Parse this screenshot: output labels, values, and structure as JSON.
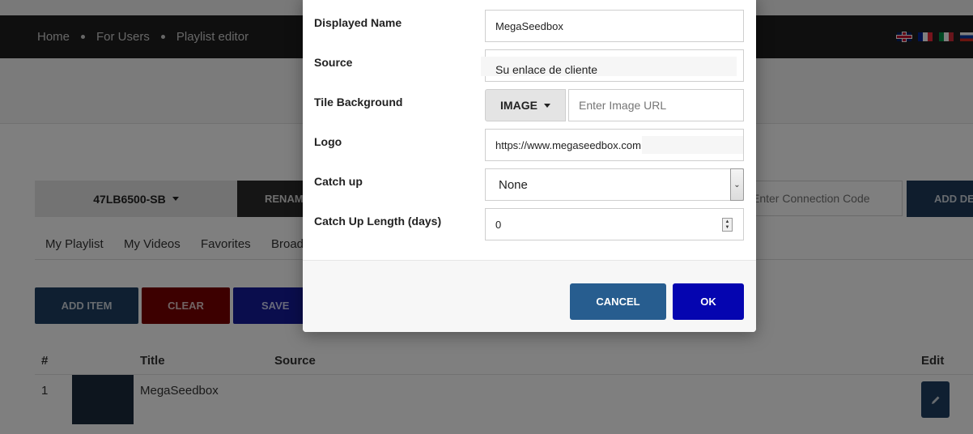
{
  "nav": {
    "breadcrumbs": [
      "Home",
      "For Users",
      "Playlist editor"
    ],
    "languages": [
      "flag-en-icon",
      "flag-fr-icon",
      "flag-it-icon",
      "flag-ru-icon"
    ]
  },
  "device": {
    "selected": "47LB6500-SB",
    "rename_label": "RENAME",
    "connection_placeholder": "Enter Connection Code",
    "add_device_label": "ADD DEVICE"
  },
  "tabs": [
    "My Playlist",
    "My Videos",
    "Favorites",
    "Broadcast"
  ],
  "actions": {
    "add_item": "ADD ITEM",
    "clear": "CLEAR",
    "save": "SAVE"
  },
  "table": {
    "headers": {
      "num": "#",
      "title": "Title",
      "source": "Source",
      "edit": "Edit"
    },
    "rows": [
      {
        "num": "1",
        "title": "MegaSeedbox"
      }
    ]
  },
  "modal": {
    "fields": {
      "displayed_name": {
        "label": "Displayed Name",
        "value": "MegaSeedbox"
      },
      "source": {
        "label": "Source",
        "value": "Su enlace de cliente"
      },
      "tile_background": {
        "label": "Tile Background",
        "button": "IMAGE",
        "placeholder": "Enter Image URL"
      },
      "logo": {
        "label": "Logo",
        "value": "https://www.megaseedbox.com"
      },
      "catch_up": {
        "label": "Catch up",
        "value": "None"
      },
      "catch_up_length": {
        "label": "Catch Up Length (days)",
        "value": "0"
      }
    },
    "cancel_label": "CANCEL",
    "ok_label": "OK"
  },
  "colors": {
    "cancel": "#275d8f",
    "ok": "#0505b0",
    "navbar": "#1e1e1e"
  }
}
